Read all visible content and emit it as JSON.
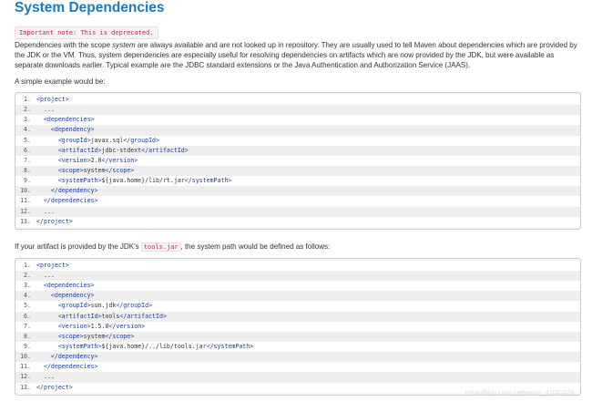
{
  "heading": "System Dependencies",
  "note": "Important note: This is deprecated.",
  "description": {
    "before_em": "Dependencies with the scope ",
    "em": "system",
    "after_em": " are always available and are not looked up in repository. They are usually used to tell Maven about dependencies which are provided by the JDK or the VM. Thus, system dependencies are especially useful for resolving dependencies on artifacts which are now provided by the JDK, but were available as separate downloads earlier. Typical example are the JDBC standard extensions or the Java Authentication and Authorization Service (JAAS)."
  },
  "example1_intro": "A simple example would be:",
  "example1_lines": [
    {
      "num": "1.",
      "indent": "",
      "open": "<project>",
      "text": "",
      "close": ""
    },
    {
      "num": "2.",
      "indent": "  ",
      "open": "",
      "text": "...",
      "close": ""
    },
    {
      "num": "3.",
      "indent": "  ",
      "open": "<dependencies>",
      "text": "",
      "close": ""
    },
    {
      "num": "4.",
      "indent": "    ",
      "open": "<dependency>",
      "text": "",
      "close": ""
    },
    {
      "num": "5.",
      "indent": "      ",
      "open": "<groupId>",
      "text": "javax.sql",
      "close": "</groupId>"
    },
    {
      "num": "6.",
      "indent": "      ",
      "open": "<artifactId>",
      "text": "jdbc-stdext",
      "close": "</artifactId>"
    },
    {
      "num": "7.",
      "indent": "      ",
      "open": "<version>",
      "text": "2.0",
      "close": "</version>"
    },
    {
      "num": "8.",
      "indent": "      ",
      "open": "<scope>",
      "text": "system",
      "close": "</scope>"
    },
    {
      "num": "9.",
      "indent": "      ",
      "open": "<systemPath>",
      "text": "${java.home}/lib/rt.jar",
      "close": "</systemPath>"
    },
    {
      "num": "10.",
      "indent": "    ",
      "open": "</dependency>",
      "text": "",
      "close": ""
    },
    {
      "num": "11.",
      "indent": "  ",
      "open": "</dependencies>",
      "text": "",
      "close": ""
    },
    {
      "num": "12.",
      "indent": "  ",
      "open": "",
      "text": "...",
      "close": ""
    },
    {
      "num": "13.",
      "indent": "",
      "open": "</project>",
      "text": "",
      "close": ""
    }
  ],
  "example2_intro": {
    "before_code": "If your artifact is provided by the JDK's ",
    "code": "tools.jar",
    "after_code": ", the system path would be defined as follows:"
  },
  "example2_lines": [
    {
      "num": "1.",
      "indent": "",
      "open": "<project>",
      "text": "",
      "close": ""
    },
    {
      "num": "2.",
      "indent": "  ",
      "open": "",
      "text": "...",
      "close": ""
    },
    {
      "num": "3.",
      "indent": "  ",
      "open": "<dependencies>",
      "text": "",
      "close": ""
    },
    {
      "num": "4.",
      "indent": "    ",
      "open": "<dependency>",
      "text": "",
      "close": ""
    },
    {
      "num": "5.",
      "indent": "      ",
      "open": "<groupId>",
      "text": "sun.jdk",
      "close": "</groupId>"
    },
    {
      "num": "6.",
      "indent": "      ",
      "open": "<artifactId>",
      "text": "tools",
      "close": "</artifactId>"
    },
    {
      "num": "7.",
      "indent": "      ",
      "open": "<version>",
      "text": "1.5.0",
      "close": "</version>"
    },
    {
      "num": "8.",
      "indent": "      ",
      "open": "<scope>",
      "text": "system",
      "close": "</scope>"
    },
    {
      "num": "9.",
      "indent": "      ",
      "open": "<systemPath>",
      "text": "${java.home}/../lib/tools.jar",
      "close": "</systemPath>"
    },
    {
      "num": "10.",
      "indent": "    ",
      "open": "</dependency>",
      "text": "",
      "close": ""
    },
    {
      "num": "11.",
      "indent": "  ",
      "open": "</dependencies>",
      "text": "",
      "close": ""
    },
    {
      "num": "12.",
      "indent": "  ",
      "open": "",
      "text": "...",
      "close": ""
    },
    {
      "num": "13.",
      "indent": "",
      "open": "</project>",
      "text": "",
      "close": ""
    }
  ],
  "watermark": "https://blog.csdn.net/weixin_41063429",
  "colors": {
    "heading": "#1a7abf",
    "code_tag": "#1b3f96",
    "inline_code": "#c7254e"
  }
}
